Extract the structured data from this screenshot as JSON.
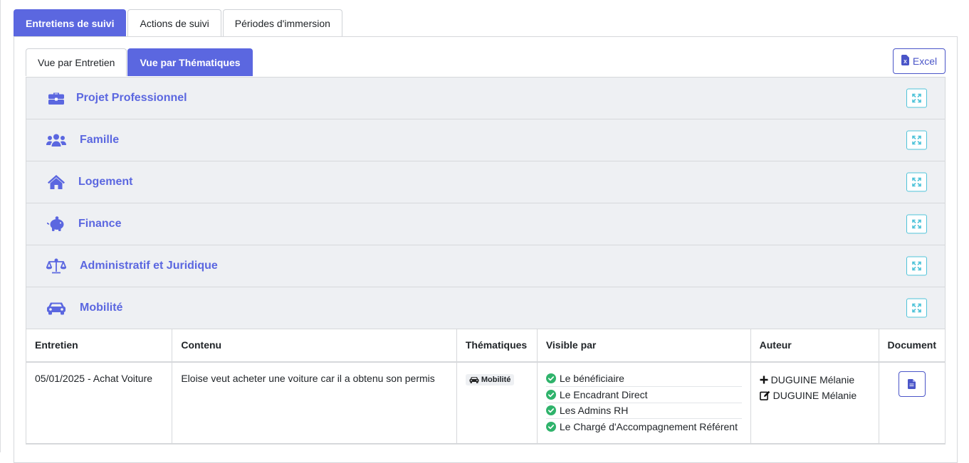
{
  "top_tabs": [
    {
      "label": "Entretiens de suivi",
      "active": true
    },
    {
      "label": "Actions de suivi",
      "active": false
    },
    {
      "label": "Périodes d'immersion",
      "active": false
    }
  ],
  "sub_tabs": [
    {
      "label": "Vue par Entretien",
      "active": false
    },
    {
      "label": "Vue par Thématiques",
      "active": true
    }
  ],
  "excel_label": "Excel",
  "themes": [
    {
      "label": "Projet Professionnel",
      "icon": "briefcase-icon"
    },
    {
      "label": "Famille",
      "icon": "users-icon"
    },
    {
      "label": "Logement",
      "icon": "home-icon"
    },
    {
      "label": "Finance",
      "icon": "piggy-bank-icon"
    },
    {
      "label": "Administratif et Juridique",
      "icon": "balance-scale-icon"
    },
    {
      "label": "Mobilité",
      "icon": "car-icon"
    }
  ],
  "table": {
    "headers": [
      "Entretien",
      "Contenu",
      "Thématiques",
      "Visible par",
      "Auteur",
      "Document"
    ],
    "rows": [
      {
        "entretien": "05/01/2025 - Achat Voiture",
        "contenu": "Eloise veut acheter une voiture car il a obtenu son permis",
        "thematique": "Mobilité",
        "visible_par": [
          "Le bénéficiaire",
          "Le Encadrant Direct",
          "Les Admins RH",
          "Le Chargé d'Accompagnement Référent"
        ],
        "created_by": "DUGUINE Mélanie",
        "edited_by": "DUGUINE Mélanie"
      }
    ]
  },
  "colors": {
    "accent": "#5b67e0",
    "accordion_bg": "#eef0f3",
    "toggle_border": "#4fc3d9",
    "check_green": "#2fb36b"
  }
}
